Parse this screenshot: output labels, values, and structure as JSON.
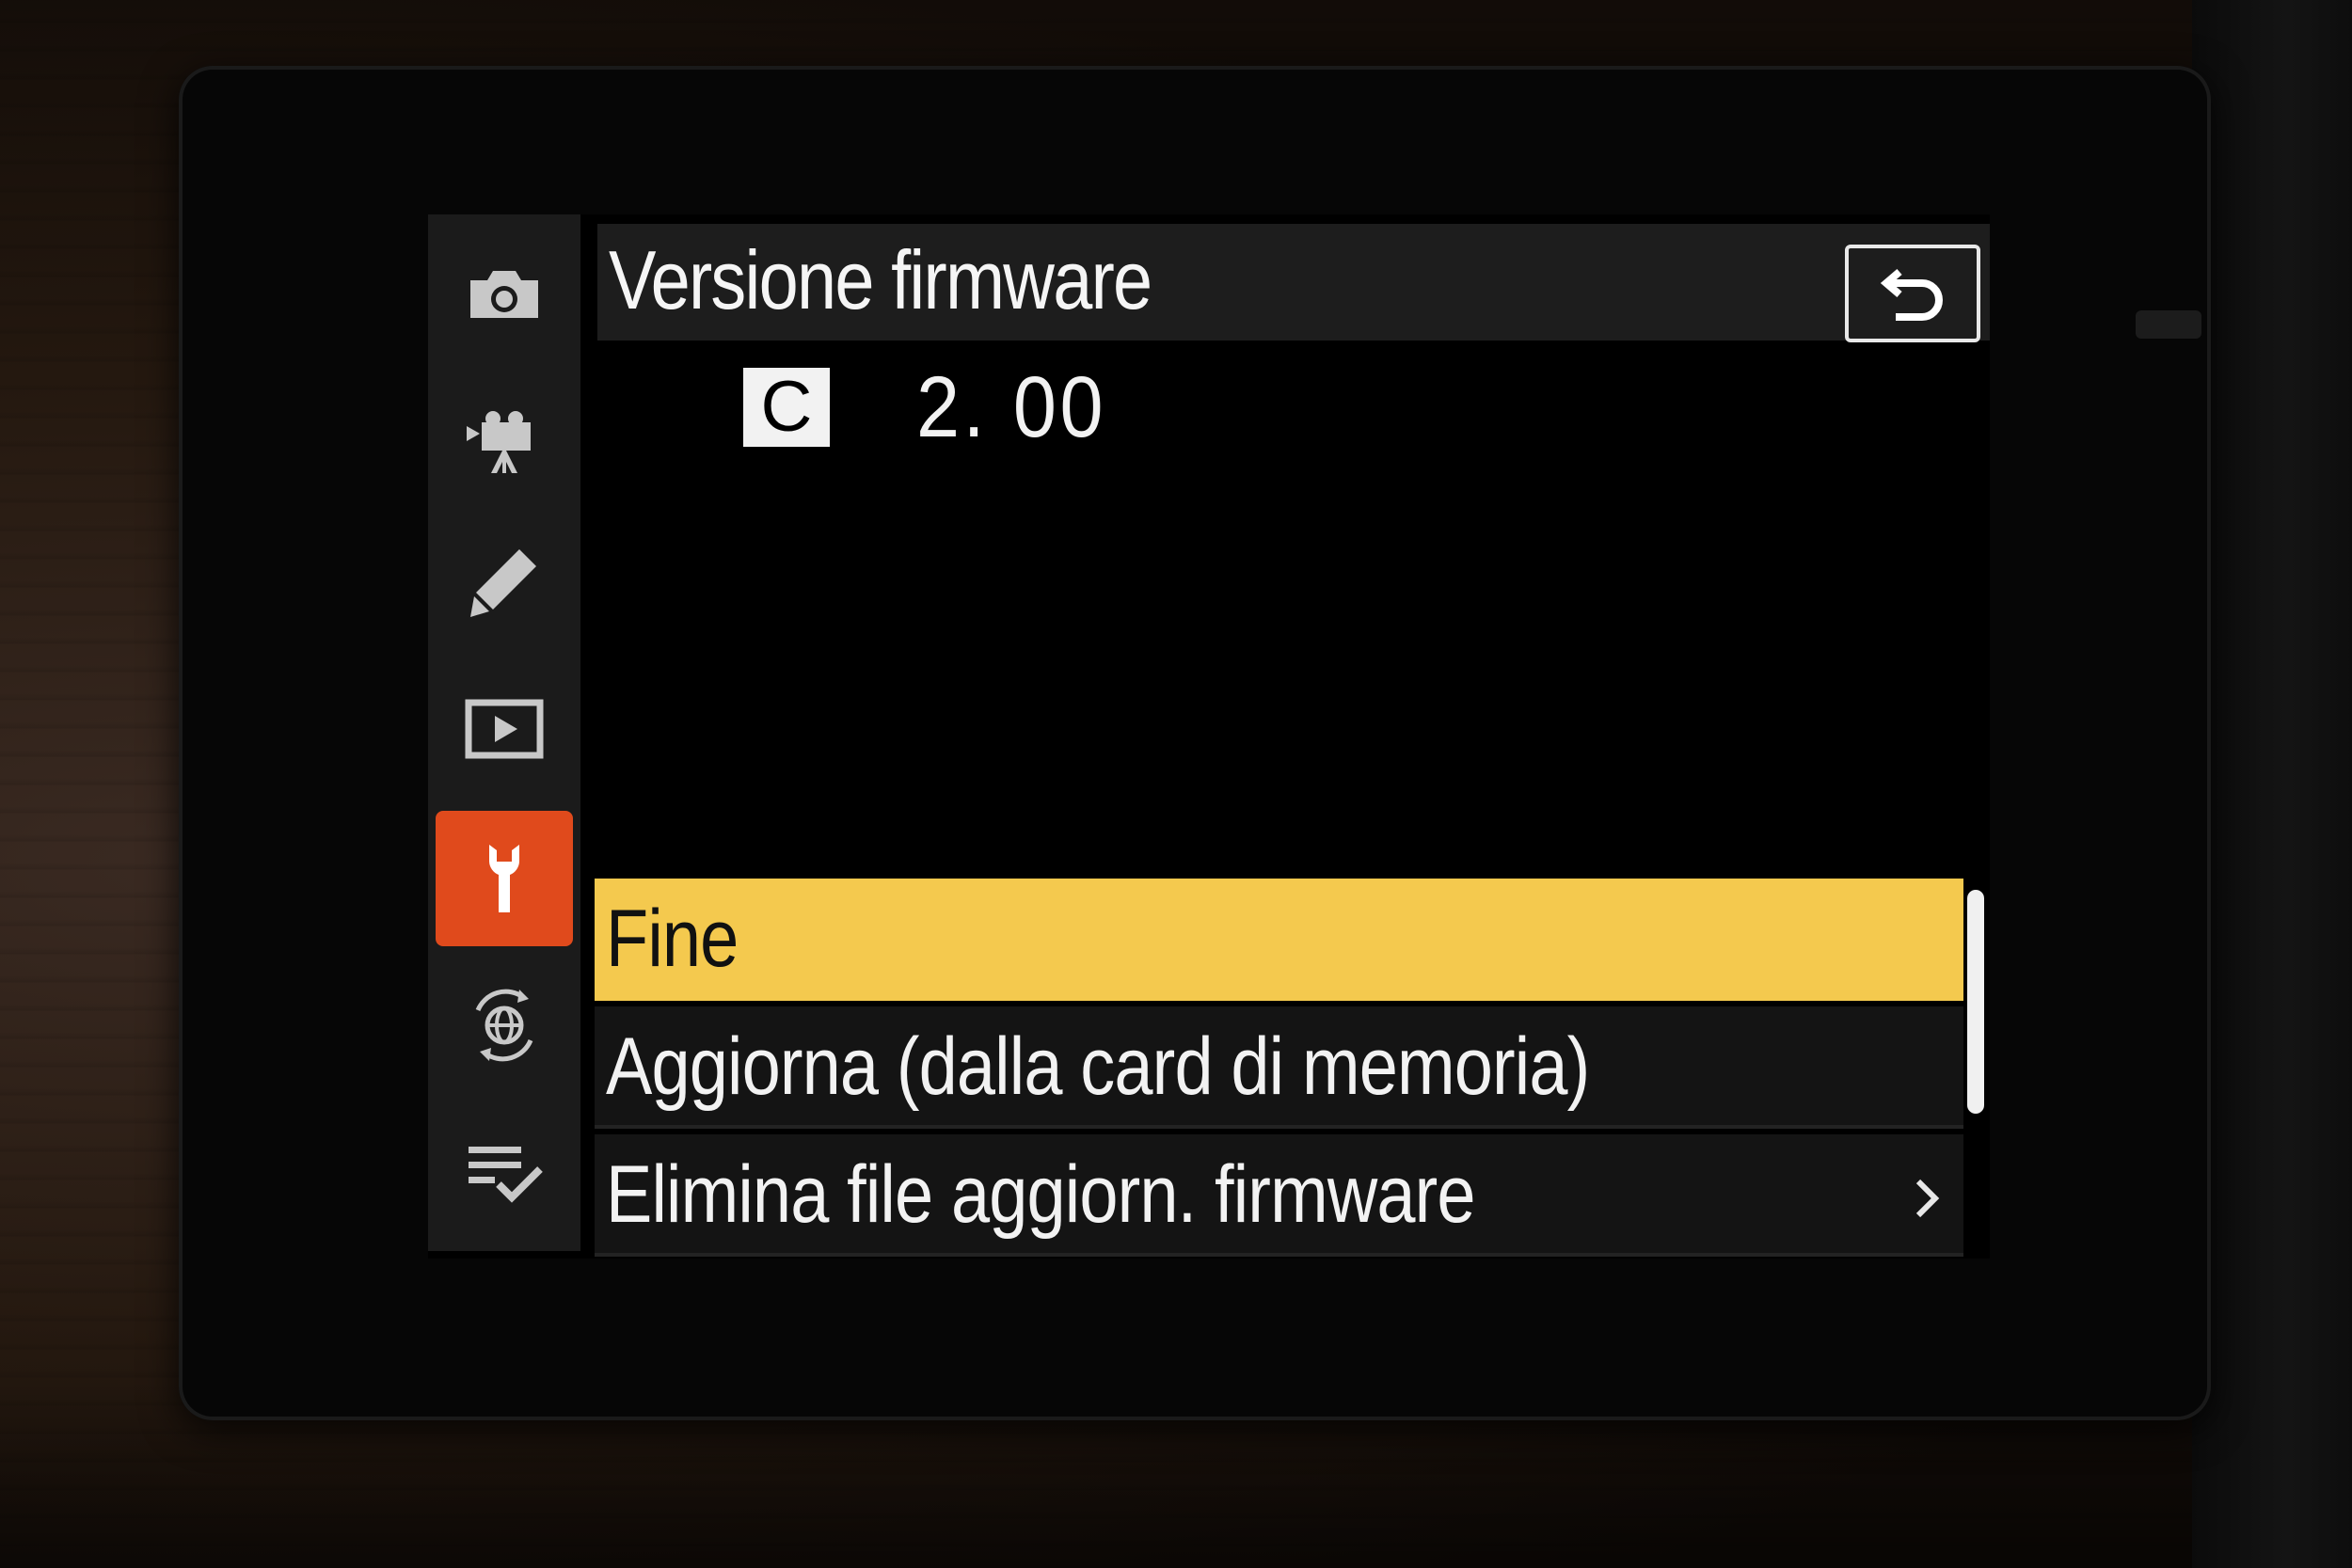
{
  "colors": {
    "accent_active_tab": "#e04a1c",
    "selected_row": "#f4c94e",
    "screen_bg": "#000000",
    "text": "#f2f2f2"
  },
  "sidebar": {
    "items": [
      {
        "icon": "camera-icon",
        "active": false
      },
      {
        "icon": "movie-camera-icon",
        "active": false
      },
      {
        "icon": "pencil-icon",
        "active": false
      },
      {
        "icon": "playback-icon",
        "active": false
      },
      {
        "icon": "wrench-icon",
        "active": true
      },
      {
        "icon": "network-globe-icon",
        "active": false
      },
      {
        "icon": "my-menu-icon",
        "active": false
      }
    ]
  },
  "header": {
    "title": "Versione firmware",
    "back_icon": "return-icon"
  },
  "firmware": {
    "badge": "C",
    "version": "2. 00"
  },
  "menu": {
    "items": [
      {
        "label": "Fine",
        "selected": true
      },
      {
        "label": "Aggiorna (dalla card di memoria)",
        "selected": false
      },
      {
        "label": "Elimina file aggiorn. firmware",
        "selected": false,
        "has_submenu": true
      }
    ]
  }
}
